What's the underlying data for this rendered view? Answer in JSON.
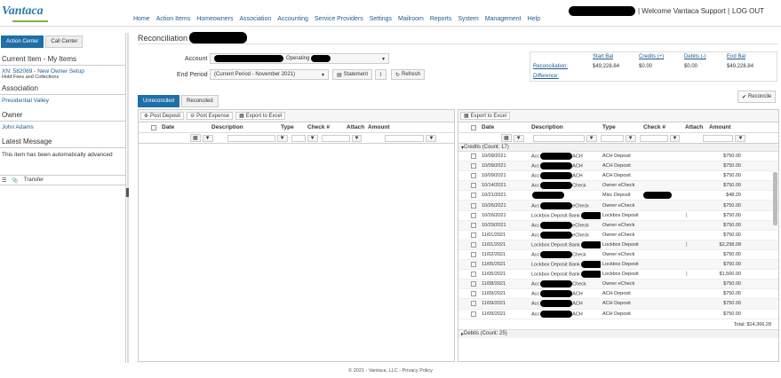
{
  "app": {
    "logo": "Vantaca"
  },
  "nav": [
    "Home",
    "Action Items",
    "Homeowners",
    "Association",
    "Accounting",
    "Service Providers",
    "Settings",
    "Mailroom",
    "Reports",
    "System",
    "Management",
    "Help"
  ],
  "header": {
    "welcome": "| Welcome Vantaca Support |",
    "logout": "LOG OUT"
  },
  "left": {
    "tabs": [
      "Action Center",
      "Call Center"
    ],
    "current_item_heading": "Current Item - My Items",
    "current_item": "XN: 582069 - New Owner Setup",
    "current_item_sub": "Hold Fees and Collections",
    "association_heading": "Association",
    "association": "Presidential Valley",
    "owner_heading": "Owner",
    "owner": "John Adams",
    "latest_heading": "Latest Message",
    "latest_message": "This item has been automatically advanced",
    "transfer": "Transfer"
  },
  "page": {
    "title": "Reconciliation",
    "account_label": "Account",
    "account_value": "Operating",
    "end_period_label": "End Period",
    "end_period_value": "(Current Period - November 2021)",
    "statement": "Statement",
    "refresh": "Refresh",
    "reconcile": "Reconcile"
  },
  "summary": {
    "headers": [
      "Start Bal",
      "Credits (+)",
      "Debits (-)",
      "End Bal"
    ],
    "row_label": "Reconciliation:",
    "diff_label": "Difference:",
    "values": [
      "$49,228.84",
      "$0.00",
      "$0.00",
      "$49,228.84"
    ]
  },
  "tabs": [
    "Unreconciled",
    "Reconciled"
  ],
  "left_panel": {
    "buttons": [
      "Post Deposit",
      "Post Expense",
      "Export to Excel"
    ],
    "columns": [
      "Date",
      "Description",
      "Type",
      "Check #",
      "Attach",
      "Amount"
    ]
  },
  "right_panel": {
    "button": "Export to Excel",
    "columns": [
      "Date",
      "Description",
      "Type",
      "Check #",
      "Attach",
      "Amount"
    ],
    "credits_group": "Credits (Count: 17)",
    "debits_group": "Debits (Count: 25)",
    "total": "Total: $14,366.28",
    "rows": [
      {
        "date": "10/09/2021",
        "desc": "Acc",
        "desc2": "ACH",
        "type": "ACH Deposit",
        "attach": false,
        "amount": "$750.00"
      },
      {
        "date": "10/09/2021",
        "desc": "Acc",
        "desc2": "ACH",
        "type": "ACH Deposit",
        "attach": false,
        "amount": "$750.00"
      },
      {
        "date": "10/09/2021",
        "desc": "Acc",
        "desc2": "ACH",
        "type": "ACH Deposit",
        "attach": false,
        "amount": "$750.00"
      },
      {
        "date": "10/14/2021",
        "desc": "Acc",
        "desc2": "Check",
        "type": "Owner eCheck",
        "attach": false,
        "amount": "$750.00"
      },
      {
        "date": "10/21/2021",
        "desc": "",
        "desc2": "",
        "type": "Misc Deposit",
        "attach": false,
        "amount": "$48.20"
      },
      {
        "date": "10/26/2021",
        "desc": "Acc",
        "desc2": "eCheck",
        "type": "Owner eCheck",
        "attach": false,
        "amount": "$750.00"
      },
      {
        "date": "10/26/2021",
        "desc": "Lockbox Deposit Bank",
        "desc2": "",
        "type": "Lockbox Deposit",
        "attach": true,
        "amount": "$750.00"
      },
      {
        "date": "10/29/2021",
        "desc": "Acc",
        "desc2": "eCheck",
        "type": "Owner eCheck",
        "attach": false,
        "amount": "$750.00"
      },
      {
        "date": "11/01/2021",
        "desc": "Acc",
        "desc2": "eCheck",
        "type": "Owner eCheck",
        "attach": false,
        "amount": "$750.00"
      },
      {
        "date": "11/01/2021",
        "desc": "Lockbox Deposit Bank",
        "desc2": "",
        "type": "Lockbox Deposit",
        "attach": true,
        "amount": "$2,298.08"
      },
      {
        "date": "11/02/2021",
        "desc": "Acc",
        "desc2": "Check",
        "type": "Owner eCheck",
        "attach": false,
        "amount": "$750.00"
      },
      {
        "date": "11/05/2021",
        "desc": "Lockbox Deposit Bank",
        "desc2": "",
        "type": "Lockbox Deposit",
        "attach": false,
        "amount": "$750.00"
      },
      {
        "date": "11/05/2021",
        "desc": "Lockbox Deposit Bank",
        "desc2": "",
        "type": "Lockbox Deposit",
        "attach": true,
        "amount": "$1,500.00"
      },
      {
        "date": "11/08/2021",
        "desc": "Acc",
        "desc2": "Check",
        "type": "Owner eCheck",
        "attach": false,
        "amount": "$750.00"
      },
      {
        "date": "11/09/2021",
        "desc": "Acc",
        "desc2": "ACH",
        "type": "ACH Deposit",
        "attach": false,
        "amount": "$750.00"
      },
      {
        "date": "11/09/2021",
        "desc": "Acc",
        "desc2": "ACH",
        "type": "ACH Deposit",
        "attach": false,
        "amount": "$750.00"
      },
      {
        "date": "11/09/2021",
        "desc": "Acc",
        "desc2": "ACH",
        "type": "ACH Deposit",
        "attach": false,
        "amount": "$750.00"
      }
    ]
  },
  "footer": "© 2021 - Vantaca, LLC - Privacy Policy"
}
